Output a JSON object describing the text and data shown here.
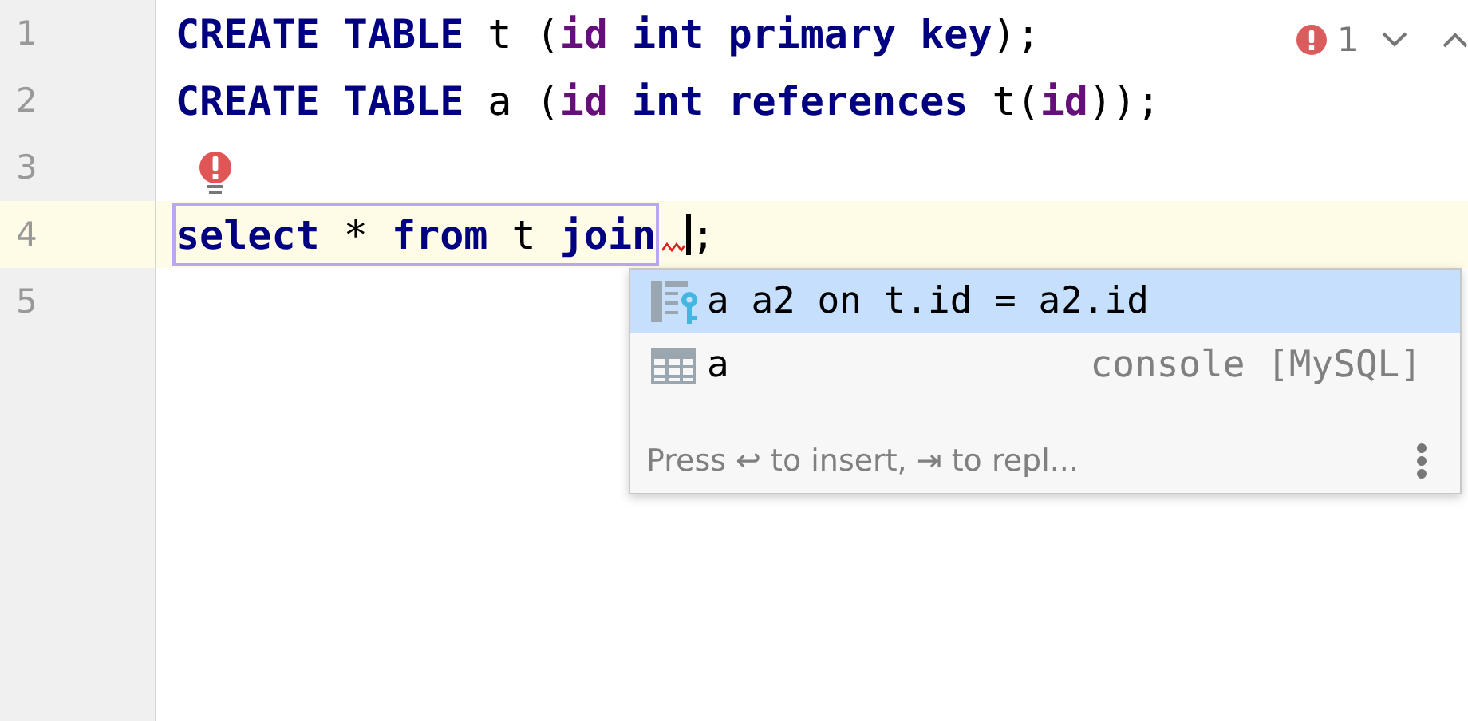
{
  "editor": {
    "lines": [
      {
        "number": "1",
        "current": false,
        "tokens": [
          {
            "text": "CREATE TABLE ",
            "kind": "keyword"
          },
          {
            "text": "t (",
            "kind": "plain"
          },
          {
            "text": "id",
            "kind": "column"
          },
          {
            "text": " int primary key",
            "kind": "keyword"
          },
          {
            "text": ");",
            "kind": "plain"
          }
        ]
      },
      {
        "number": "2",
        "current": false,
        "tokens": [
          {
            "text": "CREATE TABLE ",
            "kind": "keyword"
          },
          {
            "text": "a (",
            "kind": "plain"
          },
          {
            "text": "id",
            "kind": "column"
          },
          {
            "text": " int references ",
            "kind": "keyword"
          },
          {
            "text": "t(",
            "kind": "plain"
          },
          {
            "text": "id",
            "kind": "column"
          },
          {
            "text": "));",
            "kind": "plain"
          }
        ]
      },
      {
        "number": "3",
        "current": false,
        "bulb": true
      },
      {
        "number": "4",
        "current": true,
        "boxed": [
          {
            "text": "select",
            "kind": "keyword"
          },
          {
            "text": " * ",
            "kind": "plain"
          },
          {
            "text": "from",
            "kind": "keyword"
          },
          {
            "text": " t ",
            "kind": "plain"
          },
          {
            "text": "join",
            "kind": "keyword"
          }
        ],
        "squiggle": true,
        "caret": true,
        "tokens": [
          {
            "text": ";",
            "kind": "plain"
          }
        ]
      },
      {
        "number": "5",
        "current": false
      }
    ],
    "inspections": {
      "error_count": "1"
    }
  },
  "completion": {
    "items": [
      {
        "kind": "join",
        "text": "a a2 on t.id = a2.id",
        "selected": true
      },
      {
        "kind": "table",
        "text": "a",
        "hint": "console [MySQL]",
        "selected": false
      }
    ],
    "footer": "Press ↩ to insert, ⇥ to repl..."
  }
}
